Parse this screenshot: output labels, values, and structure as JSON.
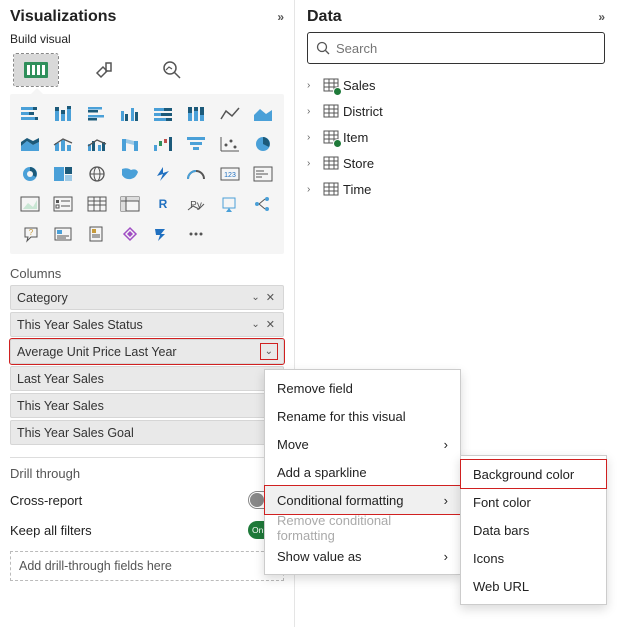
{
  "visualizations": {
    "title": "Visualizations",
    "sub": "Build visual",
    "columns_label": "Columns",
    "columns": [
      {
        "label": "Category",
        "removable": true
      },
      {
        "label": "This Year Sales Status",
        "removable": true
      },
      {
        "label": "Average Unit Price Last Year",
        "removable": false,
        "highlighted": true
      },
      {
        "label": "Last Year Sales",
        "removable": false
      },
      {
        "label": "This Year Sales",
        "removable": false
      },
      {
        "label": "This Year Sales Goal",
        "removable": false
      }
    ],
    "drill_label": "Drill through",
    "cross_report": {
      "label": "Cross-report",
      "state": "Off"
    },
    "keep_filters": {
      "label": "Keep all filters",
      "state": "On"
    },
    "drop_hint": "Add drill-through fields here"
  },
  "data": {
    "title": "Data",
    "search_placeholder": "Search",
    "tables": [
      {
        "name": "Sales",
        "checked": true
      },
      {
        "name": "District",
        "checked": false
      },
      {
        "name": "Item",
        "checked": true
      },
      {
        "name": "Store",
        "checked": false
      },
      {
        "name": "Time",
        "checked": false
      }
    ]
  },
  "context_menu": {
    "items": [
      {
        "label": "Remove field"
      },
      {
        "label": "Rename for this visual"
      },
      {
        "label": "Move",
        "submenu": true
      },
      {
        "label": "Add a sparkline"
      },
      {
        "label": "Conditional formatting",
        "submenu": true,
        "hover": true
      },
      {
        "label": "Remove conditional formatting",
        "disabled": true
      },
      {
        "label": "Show value as",
        "submenu": true
      }
    ],
    "sub_items": [
      {
        "label": "Background color",
        "hover": true
      },
      {
        "label": "Font color"
      },
      {
        "label": "Data bars"
      },
      {
        "label": "Icons"
      },
      {
        "label": "Web URL"
      }
    ]
  }
}
